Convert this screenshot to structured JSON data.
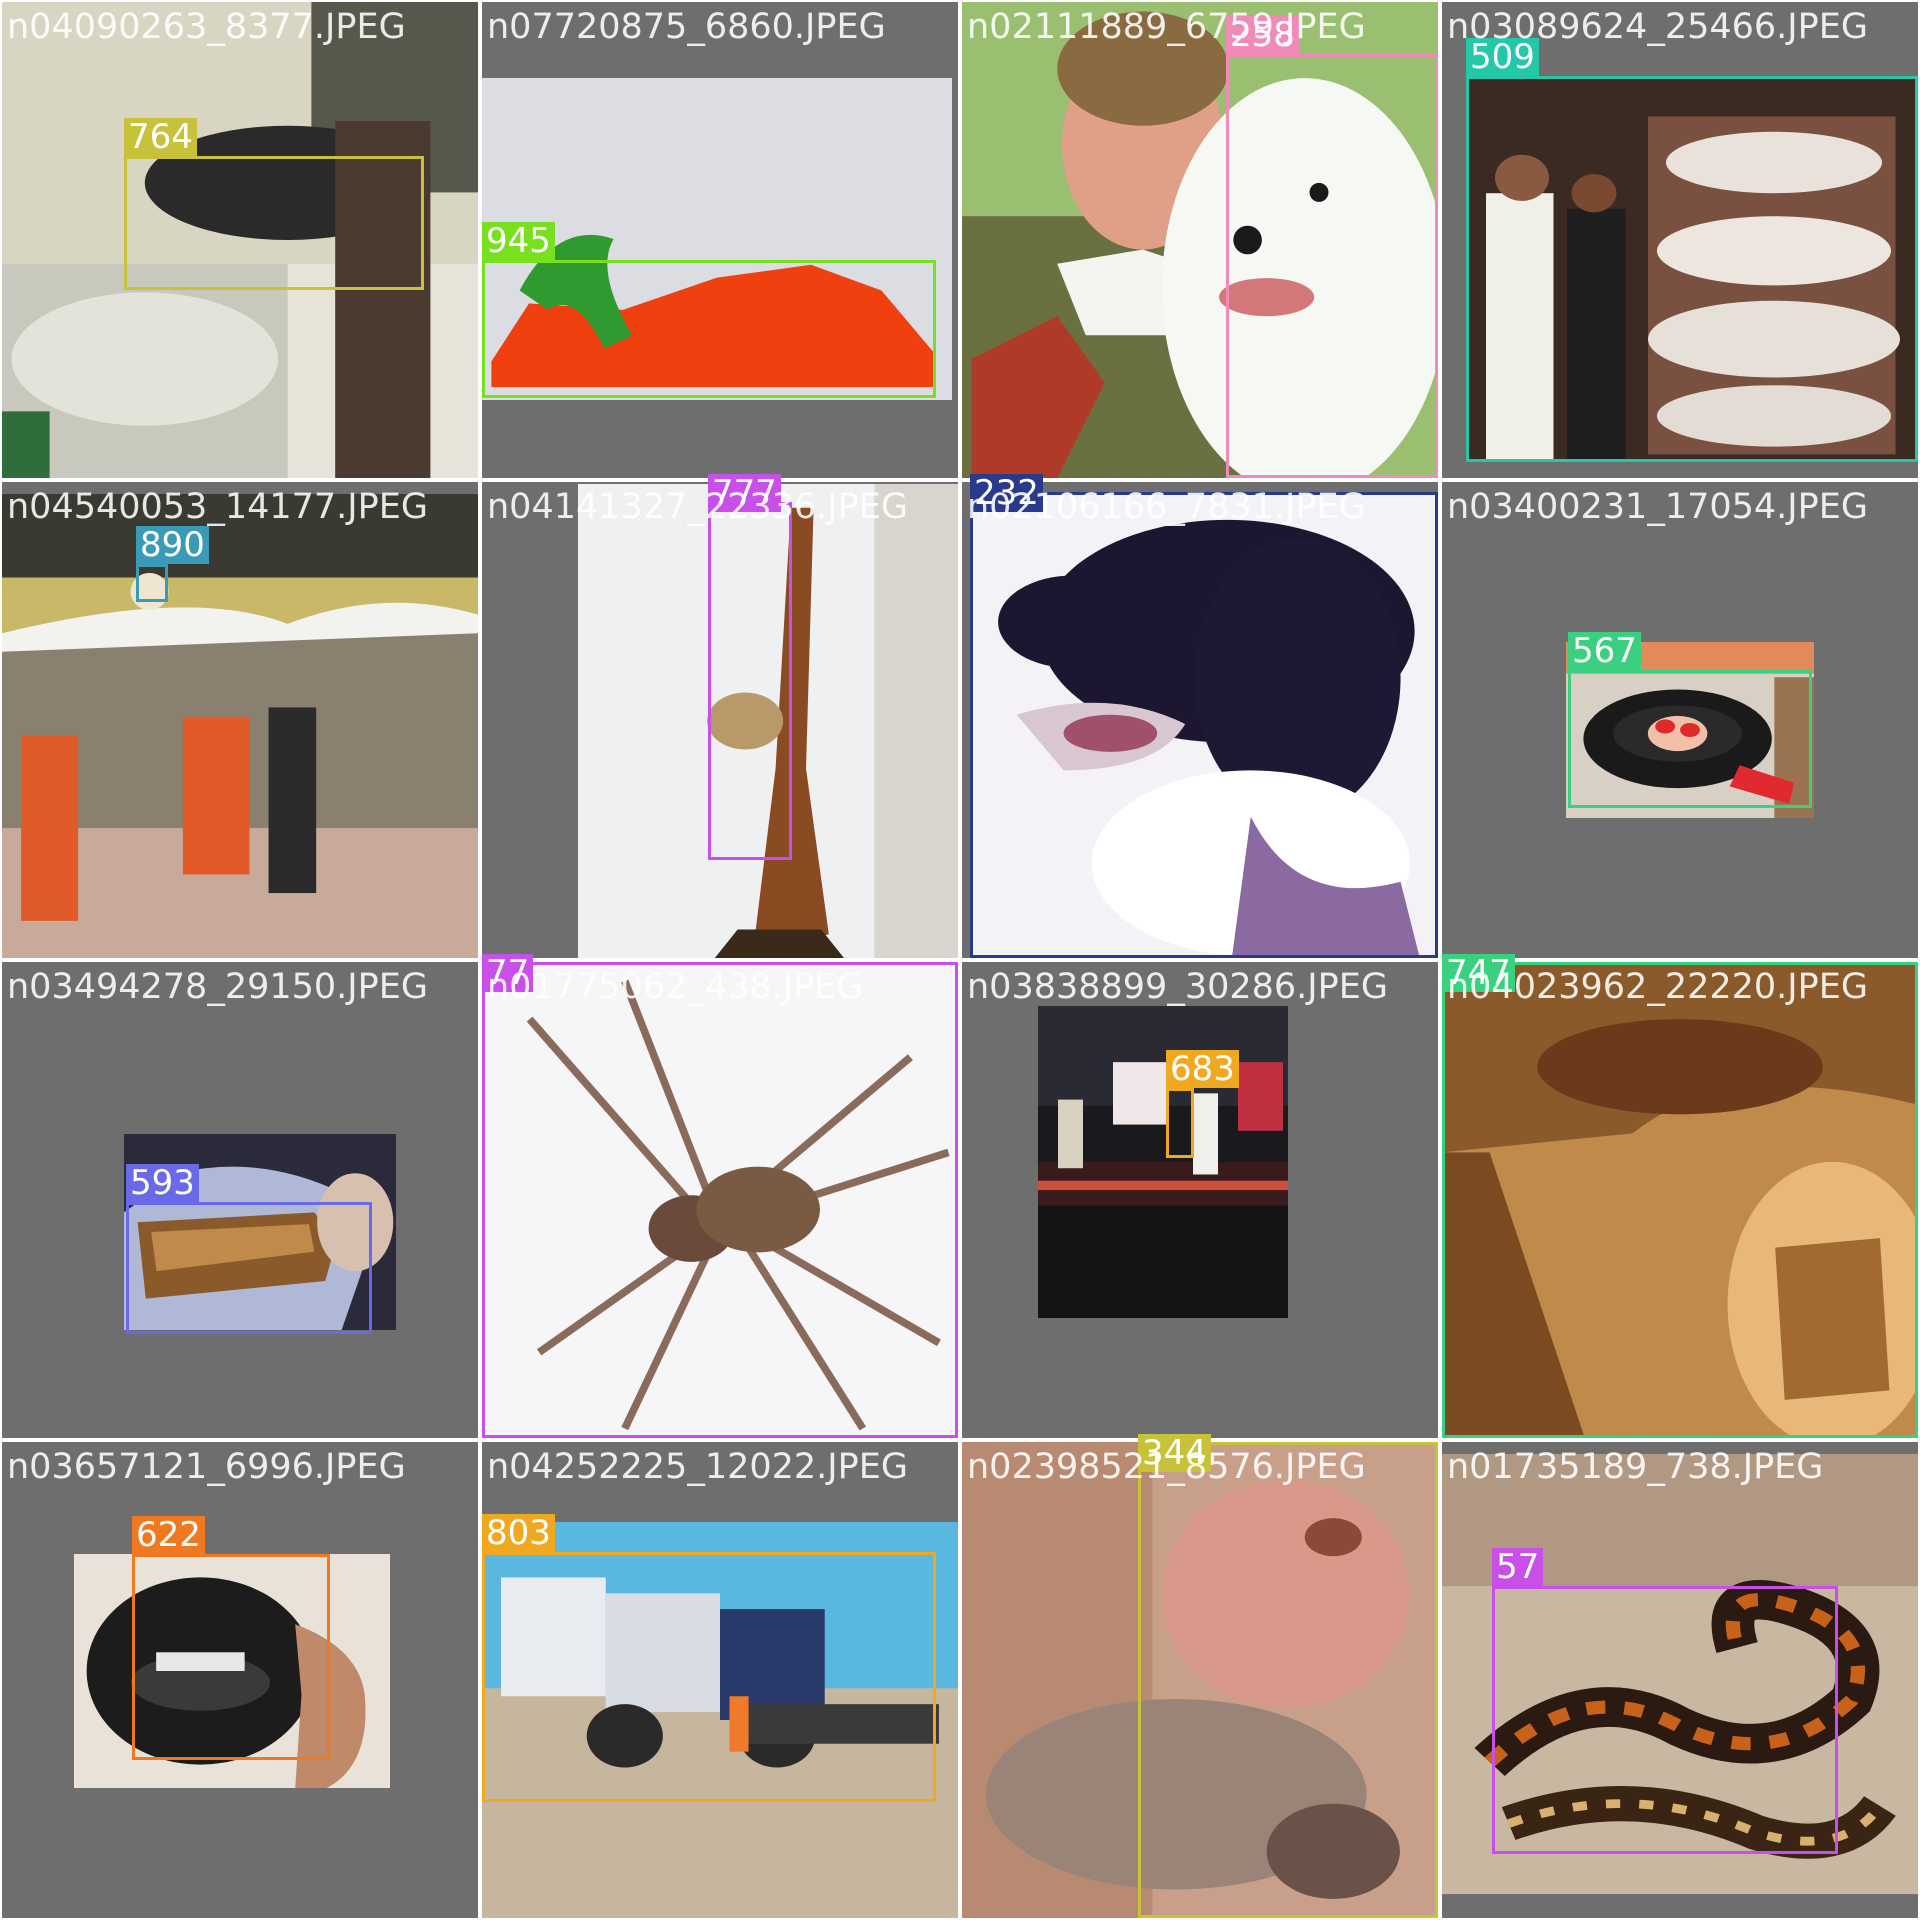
{
  "grid": {
    "rows": 4,
    "columns": 4,
    "tiles": [
      {
        "filename": "n04090263_8377.JPEG",
        "class_id": "764",
        "box_color": "#c8c23a",
        "background": "#e6e4d8",
        "picture": "bench-scene"
      },
      {
        "filename": "n07720875_6860.JPEG",
        "class_id": "945",
        "box_color": "#78e01e",
        "background": "#6e6e6e",
        "picture": "pepper"
      },
      {
        "filename": "n02111889_6759.JPEG",
        "class_id": "258",
        "box_color": "#f08ab8",
        "background": "#6e6e6e",
        "picture": "person-with-white-dog"
      },
      {
        "filename": "n03089624_25466.JPEG",
        "class_id": "509",
        "box_color": "#22c8a8",
        "background": "#6e6e6e",
        "picture": "shop-display"
      },
      {
        "filename": "n04540053_14177.JPEG",
        "class_id": "890",
        "box_color": "#3a9ab8",
        "background": "#6e6e6e",
        "picture": "volleyball-game"
      },
      {
        "filename": "n04141327_22336.JPEG",
        "class_id": "777",
        "box_color": "#c850e8",
        "background": "#6e6e6e",
        "picture": "wooden-sculpture"
      },
      {
        "filename": "n02106166_7831.JPEG",
        "class_id": "232",
        "box_color": "#2a3a8a",
        "background": "#6e6e6e",
        "picture": "black-white-dog"
      },
      {
        "filename": "n03400231_17054.JPEG",
        "class_id": "567",
        "box_color": "#3ad080",
        "background": "#6e6e6e",
        "picture": "frying-pan"
      },
      {
        "filename": "n03494278_29150.JPEG",
        "class_id": "593",
        "box_color": "#6a6ae8",
        "background": "#6e6e6e",
        "picture": "harmonica-in-hand"
      },
      {
        "filename": "n01775062_438.JPEG",
        "class_id": "77",
        "box_color": "#c850e8",
        "background": "#6e6e6e",
        "picture": "spider"
      },
      {
        "filename": "n03838899_30286.JPEG",
        "class_id": "683",
        "box_color": "#f0a820",
        "background": "#6e6e6e",
        "picture": "stage-performance"
      },
      {
        "filename": "n04023962_22220.JPEG",
        "class_id": "747",
        "box_color": "#3ad080",
        "background": "#6e6e6e",
        "picture": "punching-bag"
      },
      {
        "filename": "n03657121_6996.JPEG",
        "class_id": "622",
        "box_color": "#f07820",
        "background": "#6e6e6e",
        "picture": "lens-cap"
      },
      {
        "filename": "n04252225_12022.JPEG",
        "class_id": "803",
        "box_color": "#f0a820",
        "background": "#6e6e6e",
        "picture": "snowplow-truck"
      },
      {
        "filename": "n02398521_8576.JPEG",
        "class_id": "344",
        "box_color": "#c8c23a",
        "background": "#6e6e6e",
        "picture": "hippopotamus"
      },
      {
        "filename": "n01735189_738.JPEG",
        "class_id": "57",
        "box_color": "#c850e8",
        "background": "#6e6e6e",
        "picture": "garter-snake"
      }
    ]
  }
}
